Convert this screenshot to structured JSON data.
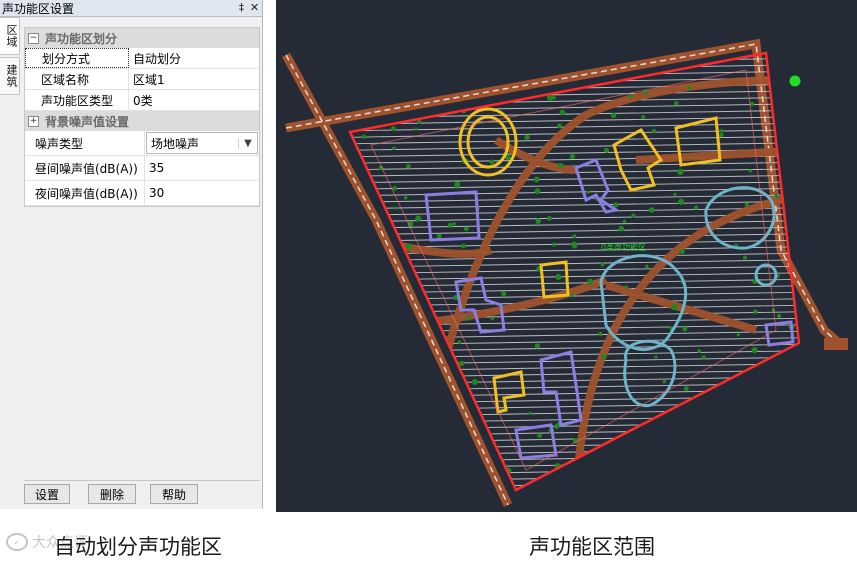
{
  "panel": {
    "title": "声功能区设置",
    "pin_glyph": "‡",
    "close_glyph": "✕",
    "vtabs": [
      "区域",
      "建筑"
    ],
    "section1": {
      "title": "声功能区划分",
      "expander": "−",
      "rows": [
        {
          "label": "划分方式",
          "value": "自动划分"
        },
        {
          "label": "区域名称",
          "value": "区域1"
        },
        {
          "label": "声功能区类型",
          "value": "0类"
        }
      ]
    },
    "section2": {
      "title": "背景噪声值设置",
      "expander": "+",
      "rows": [
        {
          "label": "噪声类型",
          "value": "场地噪声"
        },
        {
          "label": "昼间噪声值(dB(A))",
          "value": "35"
        },
        {
          "label": "夜间噪声值(dB(A))",
          "value": "30"
        }
      ]
    },
    "buttons": {
      "set": "设置",
      "delete": "删除",
      "help": "帮助"
    }
  },
  "cad_view": {
    "background": "#242b36",
    "boundary_color": "#ff2a2a",
    "road_color": "#a0522d",
    "building_yellow": "#f0c020",
    "building_purple": "#8a7ee0",
    "building_cyan": "#6fb3c8",
    "hatch_color": "#d6d6d6",
    "tree_color": "#1e8a1e",
    "marker_color": "#22dd22",
    "zone_label": "0类声功能区"
  },
  "captions": {
    "left": "自动划分声功能区",
    "right": "声功能区范围",
    "watermark": "大众点评"
  }
}
